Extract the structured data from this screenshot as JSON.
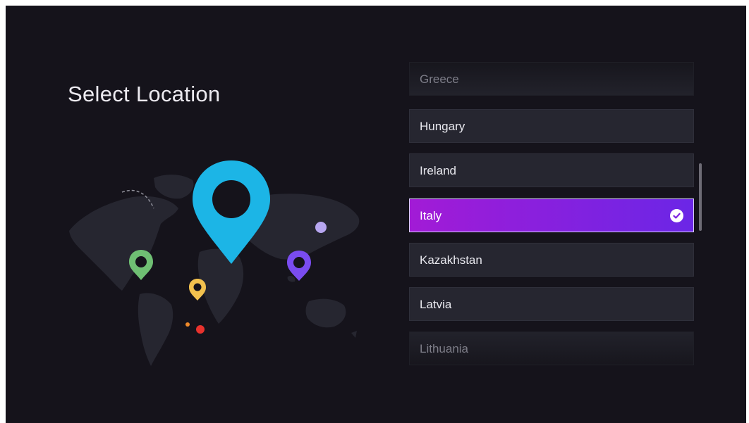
{
  "page": {
    "title": "Select Location"
  },
  "locations": [
    {
      "label": "Greece"
    },
    {
      "label": "Hungary"
    },
    {
      "label": "Ireland"
    },
    {
      "label": "Italy",
      "selected": true
    },
    {
      "label": "Kazakhstan"
    },
    {
      "label": "Latvia"
    },
    {
      "label": "Lithuania"
    }
  ],
  "selected_location": "Italy",
  "icons": {
    "selected_check": "check-circle-icon",
    "main_pin": "map-pin-icon",
    "pins": [
      "map-pin-icon-green",
      "map-pin-icon-yellow",
      "map-pin-icon-purple"
    ]
  },
  "colors": {
    "background": "#15131b",
    "item_bg": "#262630",
    "selected_gradient_start": "#a21bd6",
    "selected_gradient_end": "#6b26e6",
    "main_pin": "#1cb5e6",
    "pin_green": "#6fbf73",
    "pin_yellow": "#f2c14e",
    "pin_purple": "#7a4cf0",
    "dot_lavender": "#b7a6f0",
    "dot_red": "#e8322d",
    "dot_orange": "#f08a2a"
  }
}
